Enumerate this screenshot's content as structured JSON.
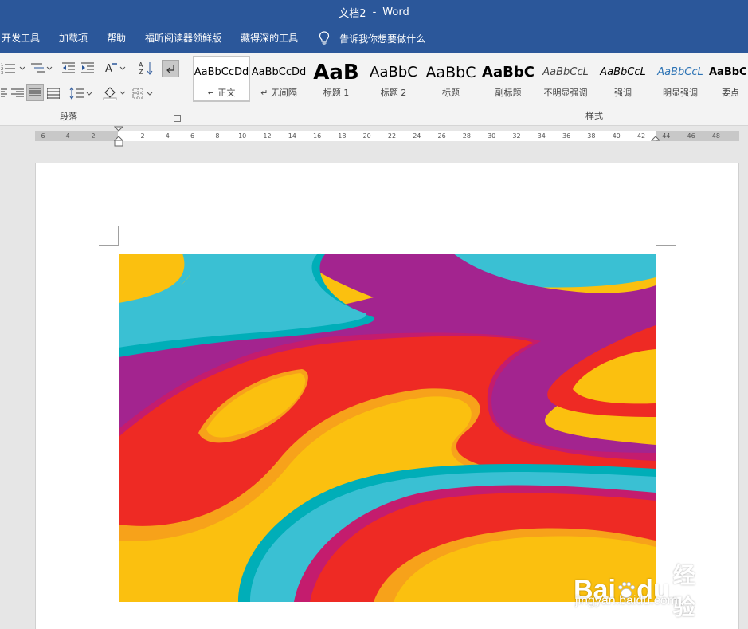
{
  "window": {
    "doc_title": "文档2",
    "separator": "-",
    "app_name": "Word"
  },
  "menu": {
    "tabs": [
      "开发工具",
      "加载项",
      "帮助",
      "福昕阅读器领鲜版",
      "藏得深的工具"
    ],
    "tell_me": "告诉我你想要做什么"
  },
  "ribbon": {
    "paragraph_group_label": "段落",
    "styles_group_label": "样式",
    "styles": [
      {
        "sample": "AaBbCcDd",
        "label": "↵ 正文",
        "selected": true
      },
      {
        "sample": "AaBbCcDd",
        "label": "↵ 无间隔"
      },
      {
        "sample": "AaB",
        "label": "标题 1"
      },
      {
        "sample": "AaBbC",
        "label": "标题 2"
      },
      {
        "sample": "AaBbC",
        "label": "标题"
      },
      {
        "sample": "AaBbC",
        "label": "副标题"
      },
      {
        "sample": "AaBbCcL",
        "label": "不明显强调"
      },
      {
        "sample": "AaBbCcL",
        "label": "强调"
      },
      {
        "sample": "AaBbCcL",
        "label": "明显强调"
      },
      {
        "sample": "AaBbC",
        "label": "要点"
      }
    ]
  },
  "ruler": {
    "left_numbers": [
      "6",
      "4",
      "2"
    ],
    "right_numbers": [
      "2",
      "4",
      "6",
      "8",
      "10",
      "12",
      "14",
      "16",
      "18",
      "20",
      "22",
      "24",
      "26",
      "28",
      "30",
      "32",
      "34",
      "36",
      "38",
      "40",
      "42",
      "44",
      "46",
      "48"
    ]
  },
  "watermark": {
    "brand": "Bai",
    "brand2": "du",
    "cn": "经验",
    "url": "jingyan.baidu.com"
  },
  "colors": {
    "title_bar": "#2b579a",
    "ribbon_bg": "#f3f3f3",
    "workspace": "#e6e6e6",
    "image_yellow": "#fbc00f",
    "image_cyan": "#3ac0d3",
    "image_purple": "#a3248f",
    "image_red": "#ee2a24",
    "image_orange": "#f7a21a"
  }
}
